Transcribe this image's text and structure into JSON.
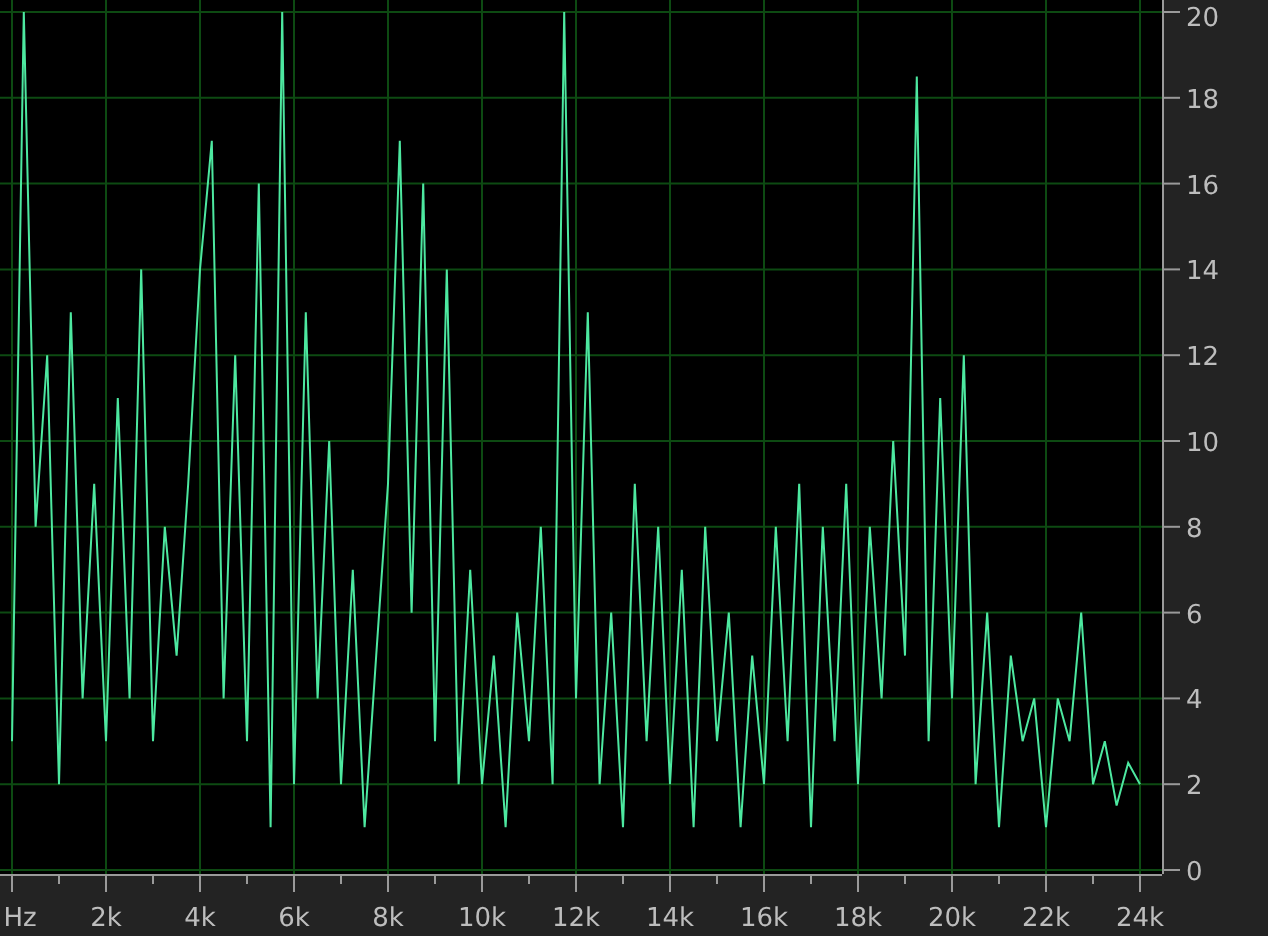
{
  "chart": {
    "chart_data": {
      "type": "line",
      "x": [
        0,
        250,
        500,
        750,
        1000,
        1250,
        1500,
        1750,
        2000,
        2250,
        2500,
        2750,
        3000,
        3250,
        3500,
        3750,
        4000,
        4250,
        4500,
        4750,
        5000,
        5250,
        5500,
        5750,
        6000,
        6250,
        6500,
        6750,
        7000,
        7250,
        7500,
        7750,
        8000,
        8250,
        8500,
        8750,
        9000,
        9250,
        9500,
        9750,
        10000,
        10250,
        10500,
        10750,
        11000,
        11250,
        11500,
        11750,
        12000,
        12250,
        12500,
        12750,
        13000,
        13250,
        13500,
        13750,
        14000,
        14250,
        14500,
        14750,
        15000,
        15250,
        15500,
        15750,
        16000,
        16250,
        16500,
        16750,
        17000,
        17250,
        17500,
        17750,
        18000,
        18250,
        18500,
        18750,
        19000,
        19250,
        19500,
        19750,
        20000,
        20250,
        20500,
        20750,
        21000,
        21250,
        21500,
        21750,
        22000,
        22250,
        22500,
        22750,
        23000,
        23250,
        23500,
        23750,
        24000
      ],
      "grid": true,
      "series": [
        {
          "color": "#4de8a0",
          "values": [
            3,
            20,
            8,
            12,
            2,
            13,
            4,
            9,
            3,
            11,
            4,
            14,
            3,
            8,
            5,
            9,
            14,
            17,
            4,
            12,
            3,
            16,
            1,
            20,
            2,
            13,
            4,
            10,
            2,
            7,
            1,
            5,
            9,
            17,
            6,
            16,
            3,
            14,
            2,
            7,
            2,
            5,
            1,
            6,
            3,
            8,
            2,
            20,
            4,
            13,
            2,
            6,
            1,
            9,
            3,
            8,
            2,
            7,
            1,
            8,
            3,
            6,
            1,
            5,
            2,
            8,
            3,
            9,
            1,
            8,
            3,
            9,
            2,
            8,
            4,
            10,
            5,
            18.5,
            3,
            11,
            4,
            12,
            2,
            6,
            1,
            5,
            3,
            4,
            1,
            4,
            3,
            6,
            2,
            3,
            1.5,
            2.5,
            2
          ]
        }
      ],
      "xlim": [
        0,
        24000
      ],
      "ylim": [
        0,
        20
      ],
      "xticks": [
        {
          "value": 0,
          "label": "Hz"
        },
        {
          "value": 2000,
          "label": "2k"
        },
        {
          "value": 4000,
          "label": "4k"
        },
        {
          "value": 6000,
          "label": "6k"
        },
        {
          "value": 8000,
          "label": "8k"
        },
        {
          "value": 10000,
          "label": "10k"
        },
        {
          "value": 12000,
          "label": "12k"
        },
        {
          "value": 14000,
          "label": "14k"
        },
        {
          "value": 16000,
          "label": "16k"
        },
        {
          "value": 18000,
          "label": "18k"
        },
        {
          "value": 20000,
          "label": "20k"
        },
        {
          "value": 22000,
          "label": "22k"
        },
        {
          "value": 24000,
          "label": "24k"
        }
      ],
      "yticks": [
        0,
        2,
        4,
        6,
        8,
        10,
        12,
        14,
        16,
        18,
        20
      ]
    }
  }
}
